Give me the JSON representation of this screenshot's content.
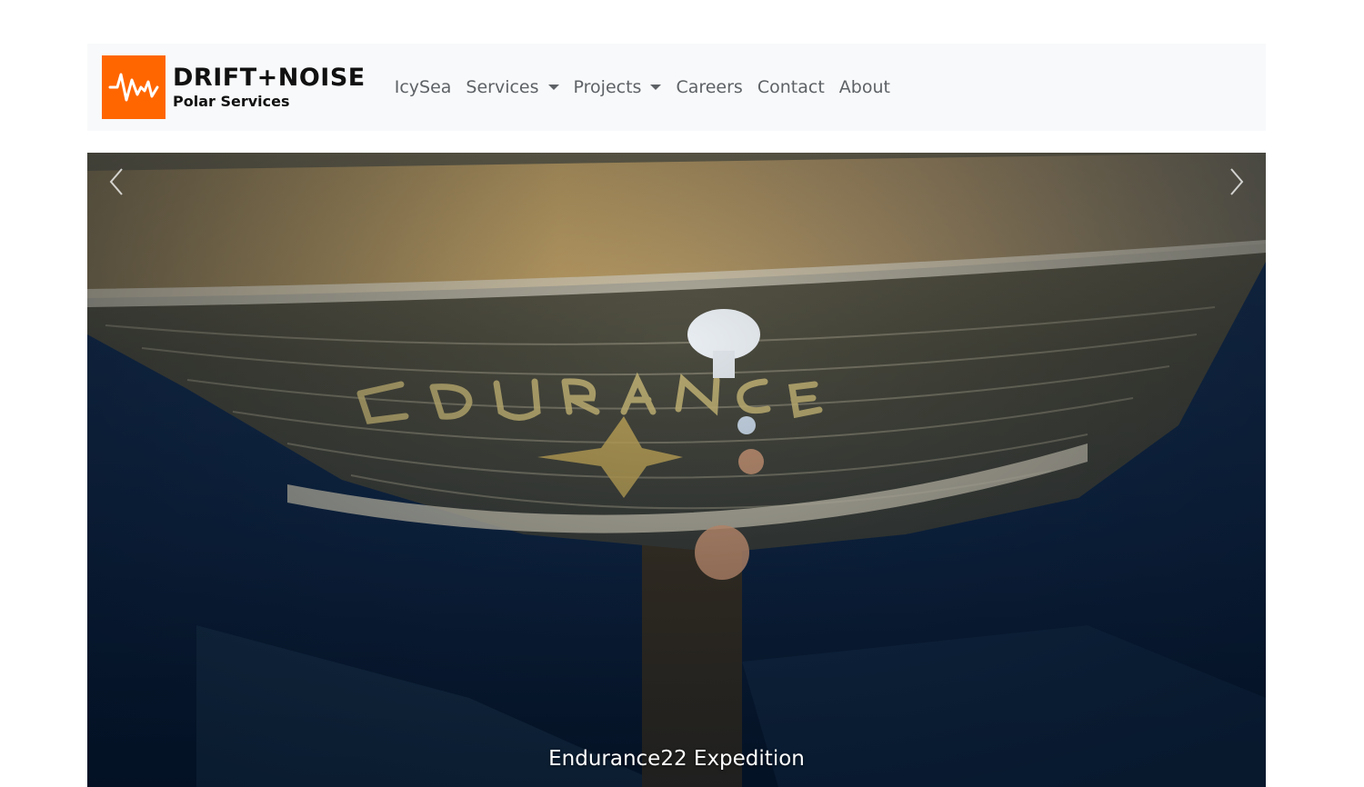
{
  "brand": {
    "name": "DRIFT+NOISE",
    "subtitle": "Polar Services",
    "logo_color": "#ff6600",
    "logo_icon": "waveform-icon"
  },
  "nav": {
    "items": [
      {
        "label": "IcySea",
        "dropdown": false
      },
      {
        "label": "Services",
        "dropdown": true
      },
      {
        "label": "Projects",
        "dropdown": true
      },
      {
        "label": "Careers",
        "dropdown": false
      },
      {
        "label": "Contact",
        "dropdown": false
      },
      {
        "label": "About",
        "dropdown": false
      }
    ],
    "text_color": "#5e6266",
    "background": "#f8f9fa"
  },
  "carousel": {
    "slide_image": "shipwreck-stern-photo",
    "caption": "Endurance22 Expedition",
    "prev_icon": "chevron-left-icon",
    "next_icon": "chevron-right-icon"
  }
}
